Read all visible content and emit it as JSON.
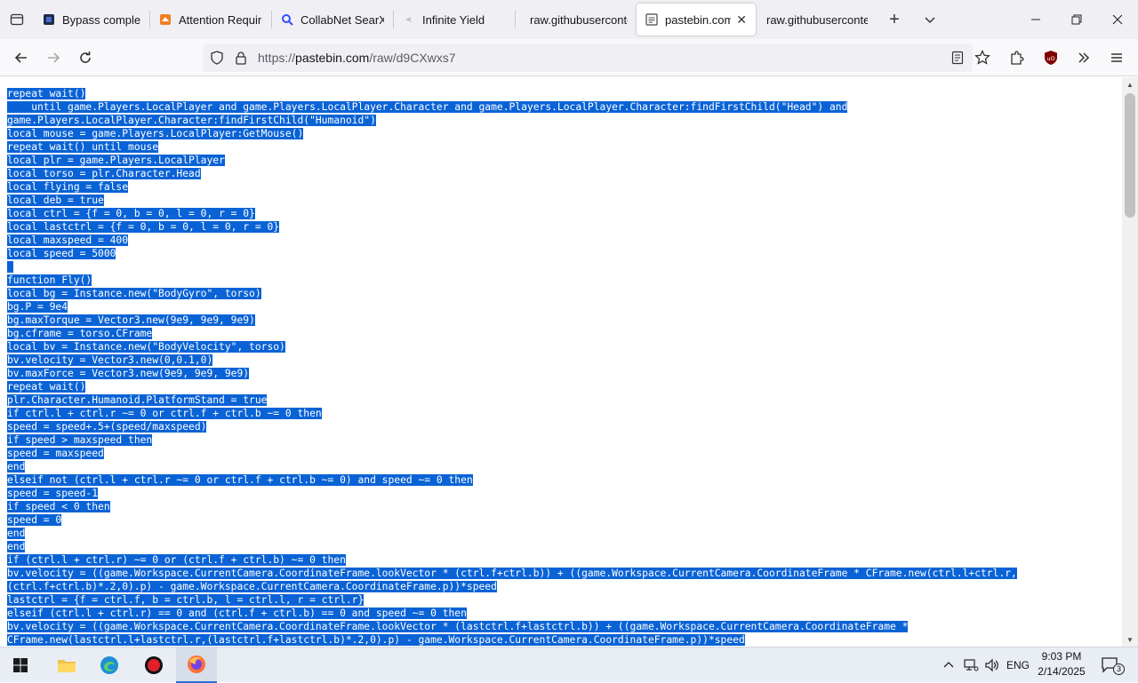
{
  "browser": {
    "tabs": [
      {
        "title": "Bypass complete |",
        "icon": "bypass-favicon-icon",
        "active": false
      },
      {
        "title": "Attention Require",
        "icon": "cloudflare-favicon-icon",
        "active": false
      },
      {
        "title": "CollabNet SearXN",
        "icon": "search-favicon-icon",
        "active": false
      },
      {
        "title": "Infinite Yield",
        "icon": "infinite-yield-favicon-icon",
        "active": false
      },
      {
        "title": "raw.githubuserconte",
        "icon": "",
        "active": false
      },
      {
        "title": "pastebin.com/r",
        "icon": "pastebin-favicon-icon",
        "active": true
      },
      {
        "title": "raw.githubuserconte",
        "icon": "",
        "active": false
      }
    ],
    "url_prefix": "https://",
    "url_host": "pastebin.com",
    "url_path": "/raw/d9CXwxs7"
  },
  "code_lines": [
    "repeat wait()",
    "    until game.Players.LocalPlayer and game.Players.LocalPlayer.Character and game.Players.LocalPlayer.Character:findFirstChild(\"Head\") and",
    "game.Players.LocalPlayer.Character:findFirstChild(\"Humanoid\")",
    "local mouse = game.Players.LocalPlayer:GetMouse()",
    "repeat wait() until mouse",
    "local plr = game.Players.LocalPlayer",
    "local torso = plr.Character.Head",
    "local flying = false",
    "local deb = true",
    "local ctrl = {f = 0, b = 0, l = 0, r = 0}",
    "local lastctrl = {f = 0, b = 0, l = 0, r = 0}",
    "local maxspeed = 400",
    "local speed = 5000",
    "",
    "function Fly()",
    "local bg = Instance.new(\"BodyGyro\", torso)",
    "bg.P = 9e4",
    "bg.maxTorque = Vector3.new(9e9, 9e9, 9e9)",
    "bg.cframe = torso.CFrame",
    "local bv = Instance.new(\"BodyVelocity\", torso)",
    "bv.velocity = Vector3.new(0,0.1,0)",
    "bv.maxForce = Vector3.new(9e9, 9e9, 9e9)",
    "repeat wait()",
    "plr.Character.Humanoid.PlatformStand = true",
    "if ctrl.l + ctrl.r ~= 0 or ctrl.f + ctrl.b ~= 0 then",
    "speed = speed+.5+(speed/maxspeed)",
    "if speed > maxspeed then",
    "speed = maxspeed",
    "end",
    "elseif not (ctrl.l + ctrl.r ~= 0 or ctrl.f + ctrl.b ~= 0) and speed ~= 0 then",
    "speed = speed-1",
    "if speed < 0 then",
    "speed = 0",
    "end",
    "end",
    "if (ctrl.l + ctrl.r) ~= 0 or (ctrl.f + ctrl.b) ~= 0 then",
    "bv.velocity = ((game.Workspace.CurrentCamera.CoordinateFrame.lookVector * (ctrl.f+ctrl.b)) + ((game.Workspace.CurrentCamera.CoordinateFrame * CFrame.new(ctrl.l+ctrl.r,",
    "(ctrl.f+ctrl.b)*.2,0).p) - game.Workspace.CurrentCamera.CoordinateFrame.p))*speed",
    "lastctrl = {f = ctrl.f, b = ctrl.b, l = ctrl.l, r = ctrl.r}",
    "elseif (ctrl.l + ctrl.r) == 0 and (ctrl.f + ctrl.b) == 0 and speed ~= 0 then",
    "bv.velocity = ((game.Workspace.CurrentCamera.CoordinateFrame.lookVector * (lastctrl.f+lastctrl.b)) + ((game.Workspace.CurrentCamera.CoordinateFrame *",
    "CFrame.new(lastctrl.l+lastctrl.r,(lastctrl.f+lastctrl.b)*.2,0).p) - game.Workspace.CurrentCamera.CoordinateFrame.p))*speed"
  ],
  "taskbar": {
    "language": "ENG",
    "time": "9:03 PM",
    "date": "2/14/2025",
    "notification_count": "3"
  },
  "colors": {
    "selection": "#0a63d6",
    "accent": "#2b6cd6"
  }
}
